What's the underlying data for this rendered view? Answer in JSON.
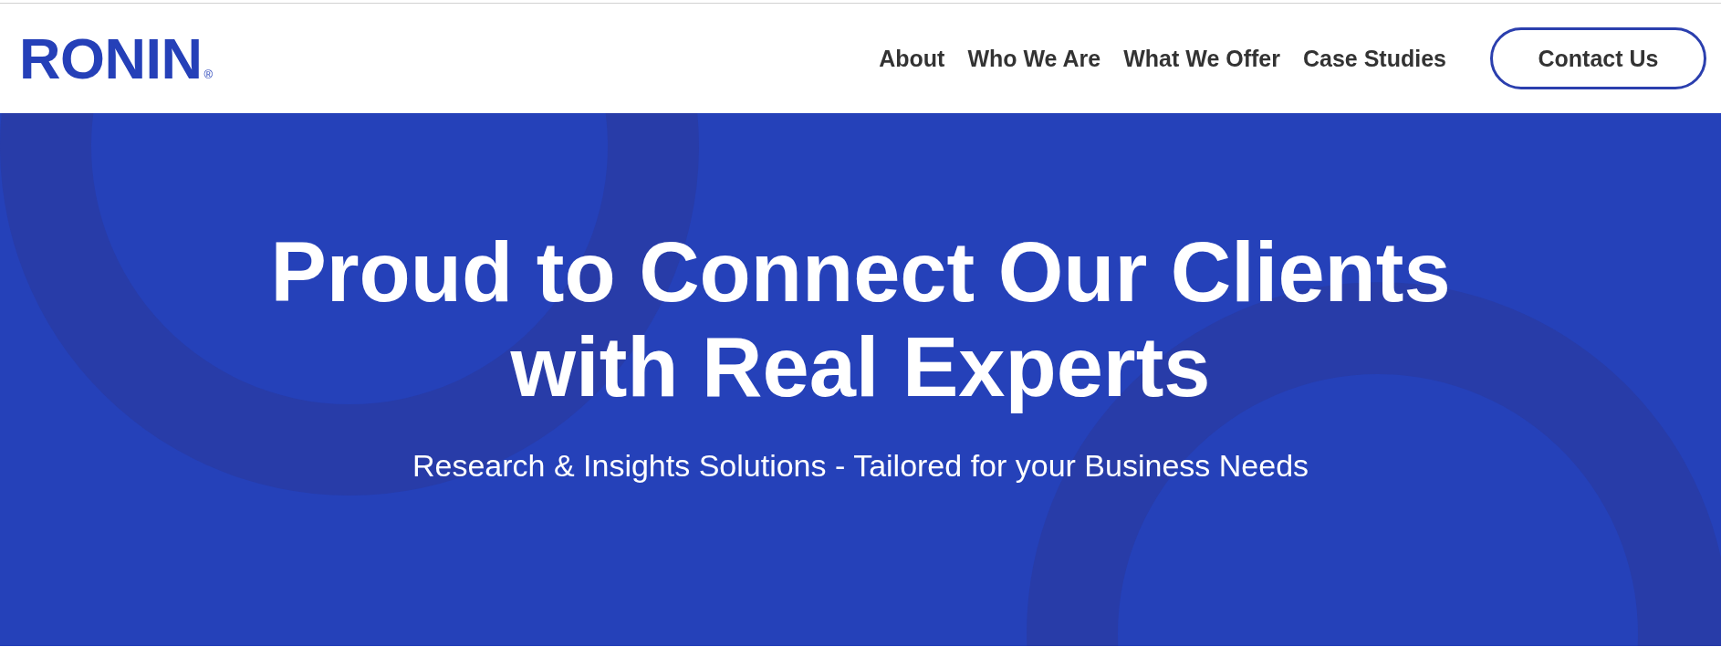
{
  "header": {
    "logo": {
      "text": "RONIN",
      "mark": "®"
    },
    "nav": [
      "About",
      "Who We Are",
      "What We Offer",
      "Case Studies"
    ],
    "cta": {
      "label": "Contact Us"
    }
  },
  "hero": {
    "title": "Proud to Connect Our Clients with Real Experts",
    "subtitle": "Research & Insights Solutions - Tailored for your Business Needs"
  }
}
